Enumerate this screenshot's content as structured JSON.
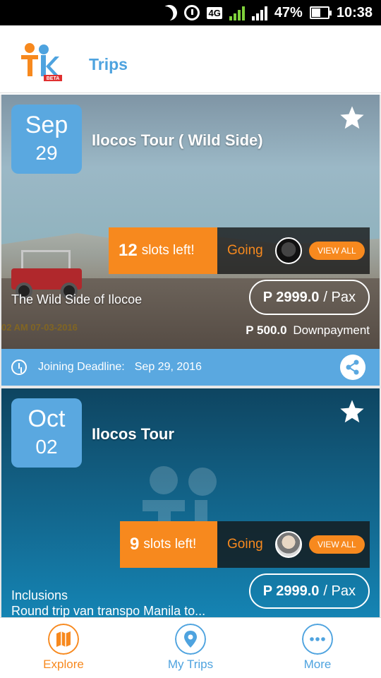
{
  "status_bar": {
    "network": "4G",
    "sim1": "1",
    "sim2": "2",
    "battery": "47%",
    "time": "10:38"
  },
  "header": {
    "logo_badge": "BETA",
    "title": "Trips"
  },
  "trips": [
    {
      "month": "Sep",
      "day": "29",
      "title": "Ilocos Tour ( Wild Side)",
      "slots_count": "12",
      "slots_text": "slots left!",
      "going_label": "Going",
      "view_all": "VIEW ALL",
      "subtitle": "The  Wild Side of Ilocoe",
      "photo_stamp": "02 AM 07-03-2016",
      "price_amount": "P 2999.0",
      "price_unit": "/ Pax",
      "downpayment_amount": "P 500.0",
      "downpayment_label": "Downpayment",
      "deadline_label": "Joining Deadline:",
      "deadline_date": "Sep 29, 2016"
    },
    {
      "month": "Oct",
      "day": "02",
      "title": "Ilocos Tour",
      "slots_count": "9",
      "slots_text": "slots left!",
      "going_label": "Going",
      "view_all": "VIEW ALL",
      "inclusions_title": "Inclusions",
      "inclusions_text": "Round trip van transpo Manila to...",
      "price_amount": "P 2999.0",
      "price_unit": "/ Pax"
    }
  ],
  "bottom_nav": {
    "explore": "Explore",
    "my_trips": "My Trips",
    "more": "More"
  },
  "colors": {
    "brand_blue": "#4ea3df",
    "brand_orange": "#f7891e"
  }
}
